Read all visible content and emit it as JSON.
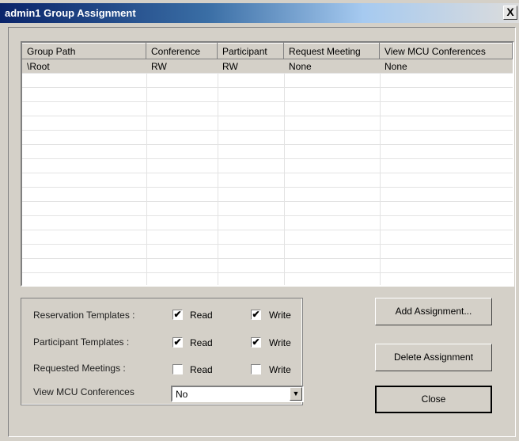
{
  "window": {
    "title": "admin1 Group Assignment",
    "close_label": "X"
  },
  "table": {
    "columns": [
      "Group Path",
      "Conference",
      "Participant",
      "Request Meeting",
      "View MCU Conferences"
    ],
    "rows": [
      [
        "\\Root",
        "RW",
        "RW",
        "None",
        "None"
      ]
    ]
  },
  "permissions": {
    "reservation_templates": {
      "label": "Reservation Templates :",
      "read_label": "Read",
      "read": true,
      "write_label": "Write",
      "write": true
    },
    "participant_templates": {
      "label": "Participant Templates  :",
      "read_label": "Read",
      "read": true,
      "write_label": "Write",
      "write": true
    },
    "requested_meetings": {
      "label": "Requested Meetings    :",
      "read_label": "Read",
      "read": false,
      "write_label": "Write",
      "write": false
    },
    "view_mcu": {
      "label": "View MCU Conferences",
      "value": "No"
    }
  },
  "buttons": {
    "add": "Add Assignment...",
    "delete": "Delete Assignment",
    "close": "Close"
  },
  "check_glyph": "✔"
}
